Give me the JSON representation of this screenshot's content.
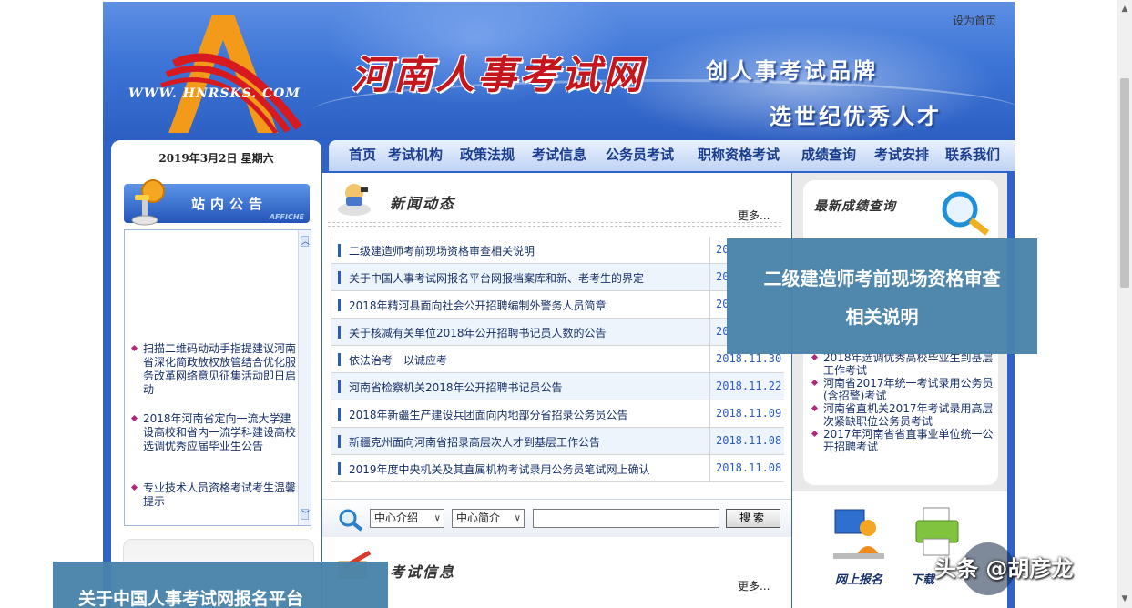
{
  "header": {
    "set_home": "设为首页",
    "logo_url": "WWW. HNRSKS. COM",
    "site_title": "河南人事考试网",
    "slogan_1": "创人事考试品牌",
    "slogan_2": "选世纪优秀人才"
  },
  "nav": [
    "首页",
    "考试机构",
    "政策法规",
    "考试信息",
    "公务员考试",
    "职称资格考试",
    "成绩查询",
    "考试安排",
    "联系我们"
  ],
  "left": {
    "date": "2019年3月2日  星期六",
    "notice_title": "站内公告",
    "notice_sub": "AFFICHE",
    "notices": [
      "扫描二维码动动手指提建议河南省深化简政放权放管结合优化服务改革网络意见征集活动即日启动",
      "2018年河南省定向一流大学建设高校和省内一流学科建设高校选调优秀应届毕业生公告",
      "专业技术人员资格考试考生温馨提示"
    ]
  },
  "news": {
    "title": "新闻动态",
    "more": "更多...",
    "items": [
      {
        "title": "二级建造师考前现场资格审查相关说明",
        "date": "20"
      },
      {
        "title": "关于中国人事考试网报名平台网报档案库和新、老考生的界定",
        "date": "20"
      },
      {
        "title": "2018年精河县面向社会公开招聘编制外警务人员简章",
        "date": "20"
      },
      {
        "title": "关于核减有关单位2018年公开招聘书记员人数的公告",
        "date": "20"
      },
      {
        "title": "依法治考　以诚应考",
        "date": "2018.11.30"
      },
      {
        "title": "河南省检察机关2018年公开招聘书记员公告",
        "date": "2018.11.22"
      },
      {
        "title": "2018年新疆生产建设兵团面向内地部分省招录公务员公告",
        "date": "2018.11.09"
      },
      {
        "title": "新疆克州面向河南省招录高层次人才到基层工作公告",
        "date": "2018.11.08"
      },
      {
        "title": "2019年度中央机关及其直属机构考试录用公务员笔试网上确认",
        "date": "2018.11.08"
      }
    ]
  },
  "search": {
    "select_1": "中心介绍",
    "select_2": "中心简介",
    "input_value": "",
    "button": "搜索"
  },
  "exam": {
    "title": "考试信息",
    "more": "更多..."
  },
  "scores": {
    "title": "最新成绩查询",
    "items": [
      "2018年选调优秀高校毕业生到基层工作考试",
      "河南省2017年统一考试录用公务员(含招警)考试",
      "河南省直机关2017年考试录用高层次紧缺职位公务员考试",
      "2017年河南省省直事业单位统一公开招聘考试"
    ]
  },
  "quick_links": [
    "网上报名",
    "下载"
  ],
  "overlays": {
    "tooltip_line_1": "二级建造师考前现场资格审查",
    "tooltip_line_2": "相关说明",
    "caption": "关于中国人事考试网报名平台",
    "watermark": "头条 @胡彦龙"
  },
  "colors": {
    "header_blue": "#3c74d6",
    "title_red": "#c4161c",
    "nav_text": "#1a3d8f",
    "overlay": "#4983aa"
  }
}
